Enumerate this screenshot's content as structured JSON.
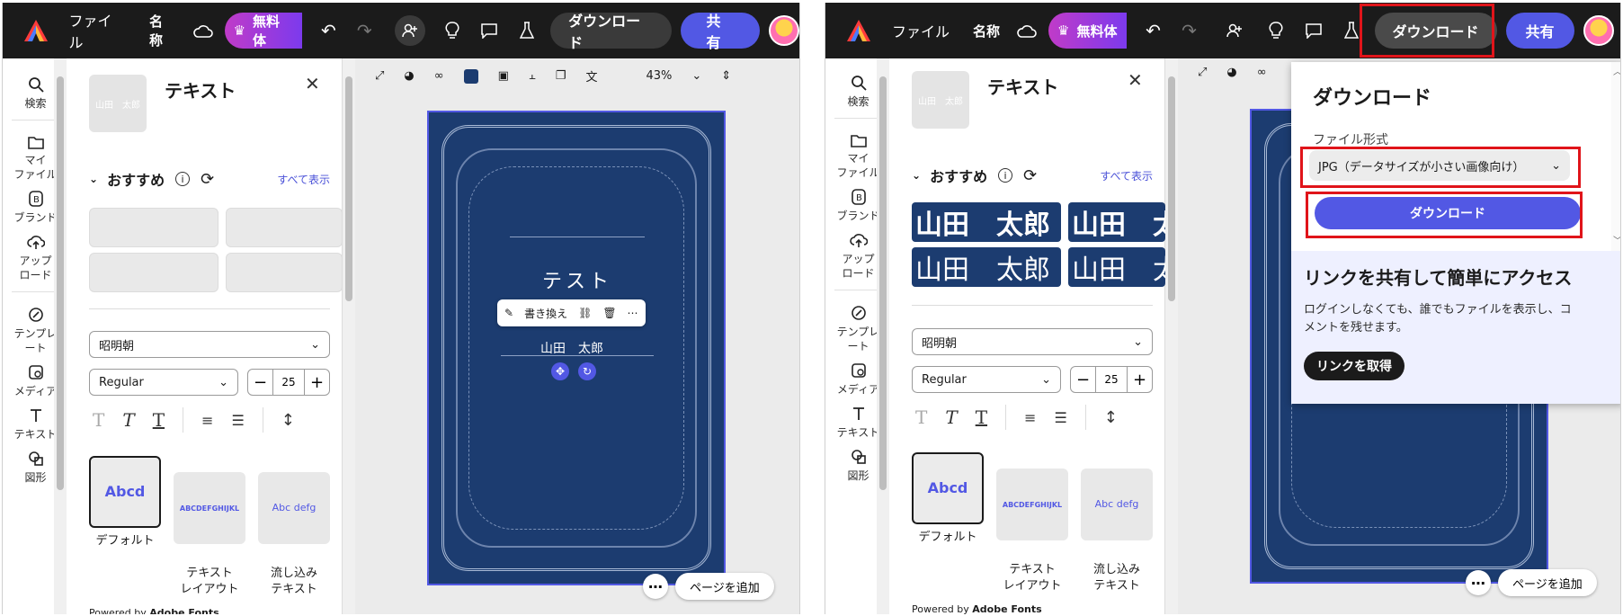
{
  "topbar": {
    "file_label": "ファイル",
    "name_label": "名称",
    "premium_label": "無料体",
    "download_label": "ダウンロード",
    "share_label": "共有"
  },
  "rail": {
    "search": "検索",
    "my_files": "マイ\nファイル",
    "brand": "ブランド",
    "upload": "アップ\nロード",
    "templates": "テンプレ\nート",
    "media": "メディア",
    "text": "テキスト",
    "shapes": "図形"
  },
  "side_panel": {
    "thumb_text": "山田　太郎",
    "title": "テキスト",
    "recommended_label": "おすすめ",
    "see_all": "すべて表示",
    "name_card_text": "山田　太郎",
    "font_name": "昭明朝",
    "font_weight": "Regular",
    "font_size": "25",
    "styles": [
      {
        "box": "Abcd",
        "label": "デフォルト"
      },
      {
        "box": "ABCDEFGHIJKL",
        "label": "テキスト\nレイアウト"
      },
      {
        "box": "Abc defg",
        "label": "流し込み\nテキスト"
      }
    ],
    "powered_prefix": "Powered by ",
    "powered_brand": "Adobe Fonts"
  },
  "canvas": {
    "zoom": "43%",
    "page_title": "テスト",
    "name_text": "山田　太郎",
    "rewrite_label": "書き換え",
    "add_page_label": "ページを追加"
  },
  "download_popup": {
    "title": "ダウンロード",
    "format_label": "ファイル形式",
    "format_value": "JPG（データサイズが小さい画像向け）",
    "download_button": "ダウンロード",
    "share_title": "リンクを共有して簡単にアクセス",
    "share_desc": "ログインしなくても、誰でもファイルを表示し、コメントを残せます。",
    "get_link_button": "リンクを取得"
  },
  "colors": {
    "accent": "#5258e4",
    "page_bg": "#1c3c70",
    "highlight": "#e0141a"
  }
}
